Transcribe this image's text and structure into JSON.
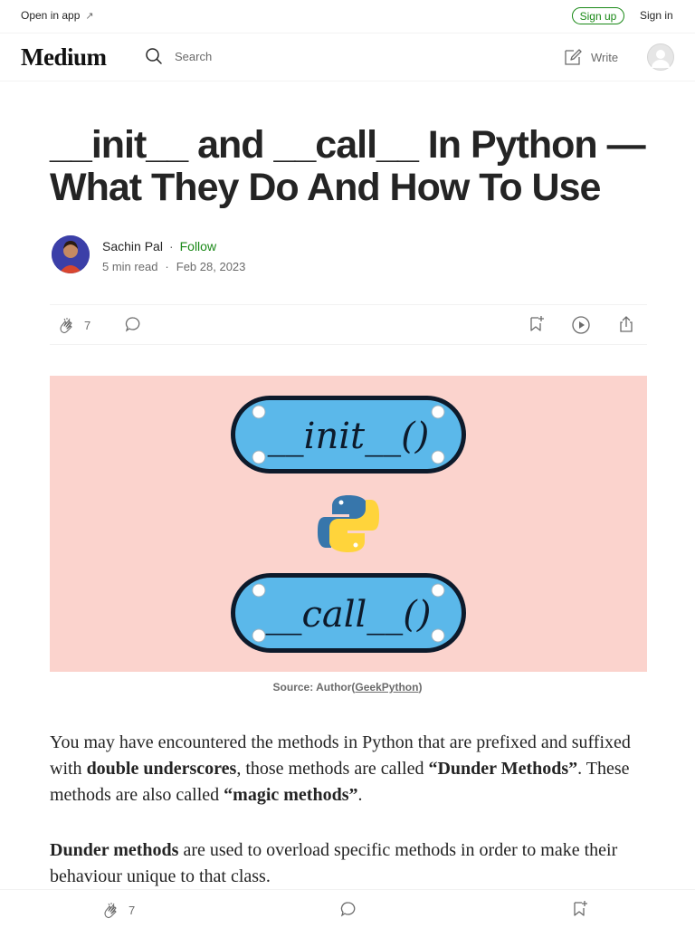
{
  "topbar": {
    "open_in_app": "Open in app",
    "sign_up": "Sign up",
    "sign_in": "Sign in"
  },
  "header": {
    "logo": "Medium",
    "search_placeholder": "Search",
    "write": "Write"
  },
  "article": {
    "title_line1": "__init__ and __call__ In Python —",
    "title_line2": "What They Do And How To Use",
    "author": {
      "name": "Sachin Pal",
      "follow": "Follow",
      "read_time": "5 min read",
      "date": "Feb 28, 2023"
    },
    "claps": "7",
    "hero_image": {
      "label_top": "__init__()",
      "label_bottom": "__call__()",
      "caption_prefix": "Source: Author(",
      "caption_link": "GeekPython",
      "caption_suffix": ")"
    },
    "paragraph1": {
      "t1": "You may have encountered the methods in Python that are prefixed and suffixed with ",
      "b1": "double underscores",
      "t2": ", those methods are called ",
      "b2": "“Dunder Methods”",
      "t3": ". These methods are also called ",
      "b3": "“magic methods”",
      "t4": "."
    },
    "paragraph2": {
      "b1": "Dunder methods",
      "t1": " are used to overload specific methods in order to make their behaviour unique to that class."
    }
  },
  "bottombar": {
    "claps": "7"
  },
  "colors": {
    "accent_green": "#1a8917",
    "hero_bg": "#fbd3cd",
    "pill_blue": "#5bb8ea",
    "python_blue": "#3776ab",
    "python_yellow": "#ffd43b"
  }
}
